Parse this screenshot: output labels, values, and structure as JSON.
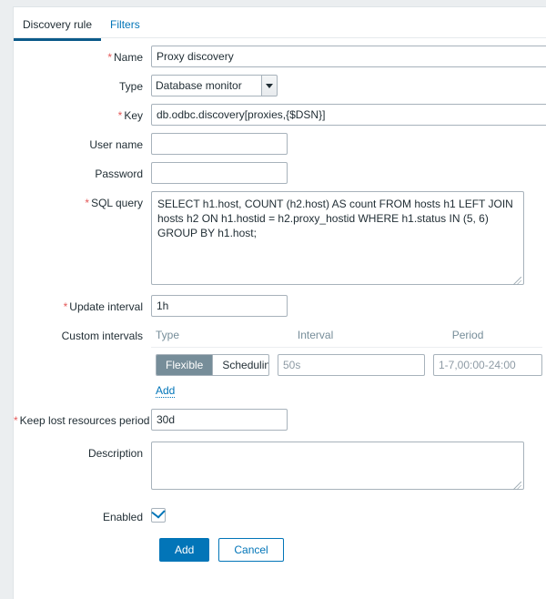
{
  "window": {
    "accent_color": "#0275b8",
    "required_marker_color": "#e45959",
    "panel_background": "#ffffff",
    "page_background": "#ebeef0",
    "segment_selected_color": "#768d99"
  },
  "tabs": [
    {
      "label": "Discovery rule",
      "active": true
    },
    {
      "label": "Filters",
      "active": false
    }
  ],
  "form": {
    "name": {
      "label": "Name",
      "required": true,
      "value": "Proxy discovery",
      "placeholder": ""
    },
    "type": {
      "label": "Type",
      "required": false,
      "value": "Database monitor",
      "options": [
        "Database monitor"
      ]
    },
    "key": {
      "label": "Key",
      "required": true,
      "value": "db.odbc.discovery[proxies,{$DSN}]",
      "placeholder": ""
    },
    "user_name": {
      "label": "User name",
      "required": false,
      "value": "",
      "placeholder": ""
    },
    "password": {
      "label": "Password",
      "required": false,
      "value": "",
      "placeholder": ""
    },
    "sql_query": {
      "label": "SQL query",
      "required": true,
      "value": "SELECT h1.host, COUNT (h2.host) AS count FROM hosts h1 LEFT JOIN hosts h2 ON h1.hostid = h2.proxy_hostid WHERE h1.status IN (5, 6) GROUP BY h1.host;",
      "placeholder": ""
    },
    "update_interval": {
      "label": "Update interval",
      "required": true,
      "value": "1h",
      "placeholder": ""
    },
    "custom_intervals": {
      "label": "Custom intervals",
      "required": false,
      "columns": [
        "Type",
        "Interval",
        "Period"
      ],
      "rows": [
        {
          "type_options": [
            "Flexible",
            "Scheduling"
          ],
          "type_selected": "Flexible",
          "interval_value": "",
          "interval_placeholder": "50s",
          "period_value": "",
          "period_placeholder": "1-7,00:00-24:00"
        }
      ],
      "add_label": "Add"
    },
    "keep_lost_resources_period": {
      "label": "Keep lost resources period",
      "required": true,
      "value": "30d",
      "placeholder": ""
    },
    "description": {
      "label": "Description",
      "required": false,
      "value": "",
      "placeholder": ""
    },
    "enabled": {
      "label": "Enabled",
      "required": false,
      "checked": true
    }
  },
  "footer": {
    "submit_label": "Add",
    "cancel_label": "Cancel"
  }
}
